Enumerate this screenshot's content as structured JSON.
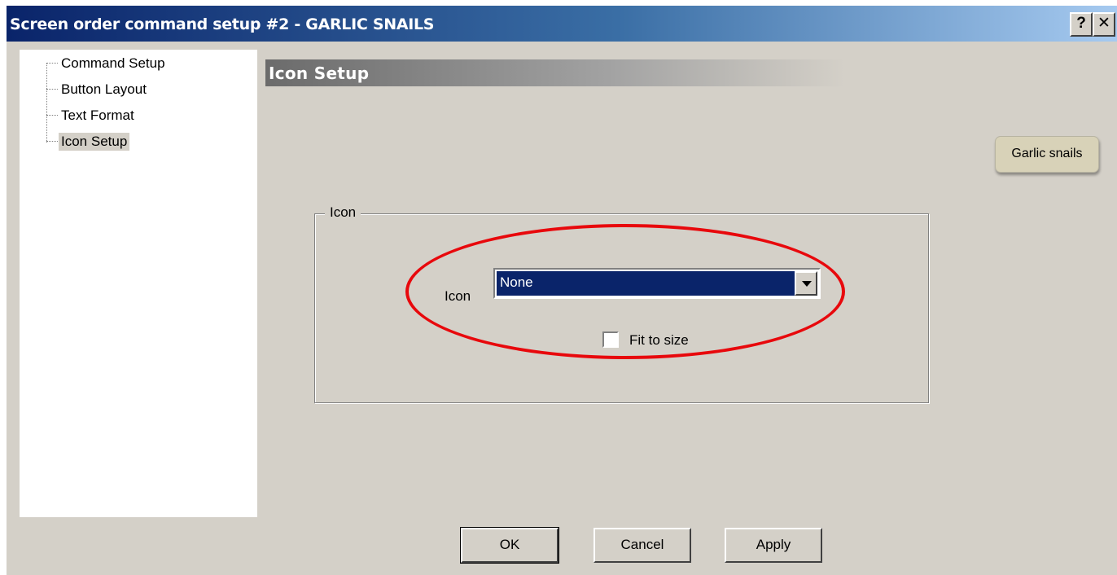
{
  "window": {
    "title": "Screen order command setup #2 - GARLIC SNAILS",
    "help_label": "?",
    "close_label": "✕"
  },
  "tree": {
    "items": [
      {
        "label": "Command Setup",
        "selected": false
      },
      {
        "label": "Button Layout",
        "selected": false
      },
      {
        "label": "Text Format",
        "selected": false
      },
      {
        "label": "Icon Setup",
        "selected": true
      }
    ]
  },
  "panel": {
    "title": "Icon Setup",
    "preview_button_label": "Garlic snails",
    "group": {
      "legend": "Icon",
      "icon_label": "Icon",
      "icon_value": "None",
      "fit_to_size_label": "Fit to size",
      "fit_to_size_checked": false
    }
  },
  "buttons": {
    "ok": "OK",
    "cancel": "Cancel",
    "apply": "Apply"
  },
  "colors": {
    "title_bar": "#0a246a",
    "dialog_bg": "#d4d0c8",
    "selection": "#0a246a",
    "highlight_ellipse": "#e8080c"
  }
}
